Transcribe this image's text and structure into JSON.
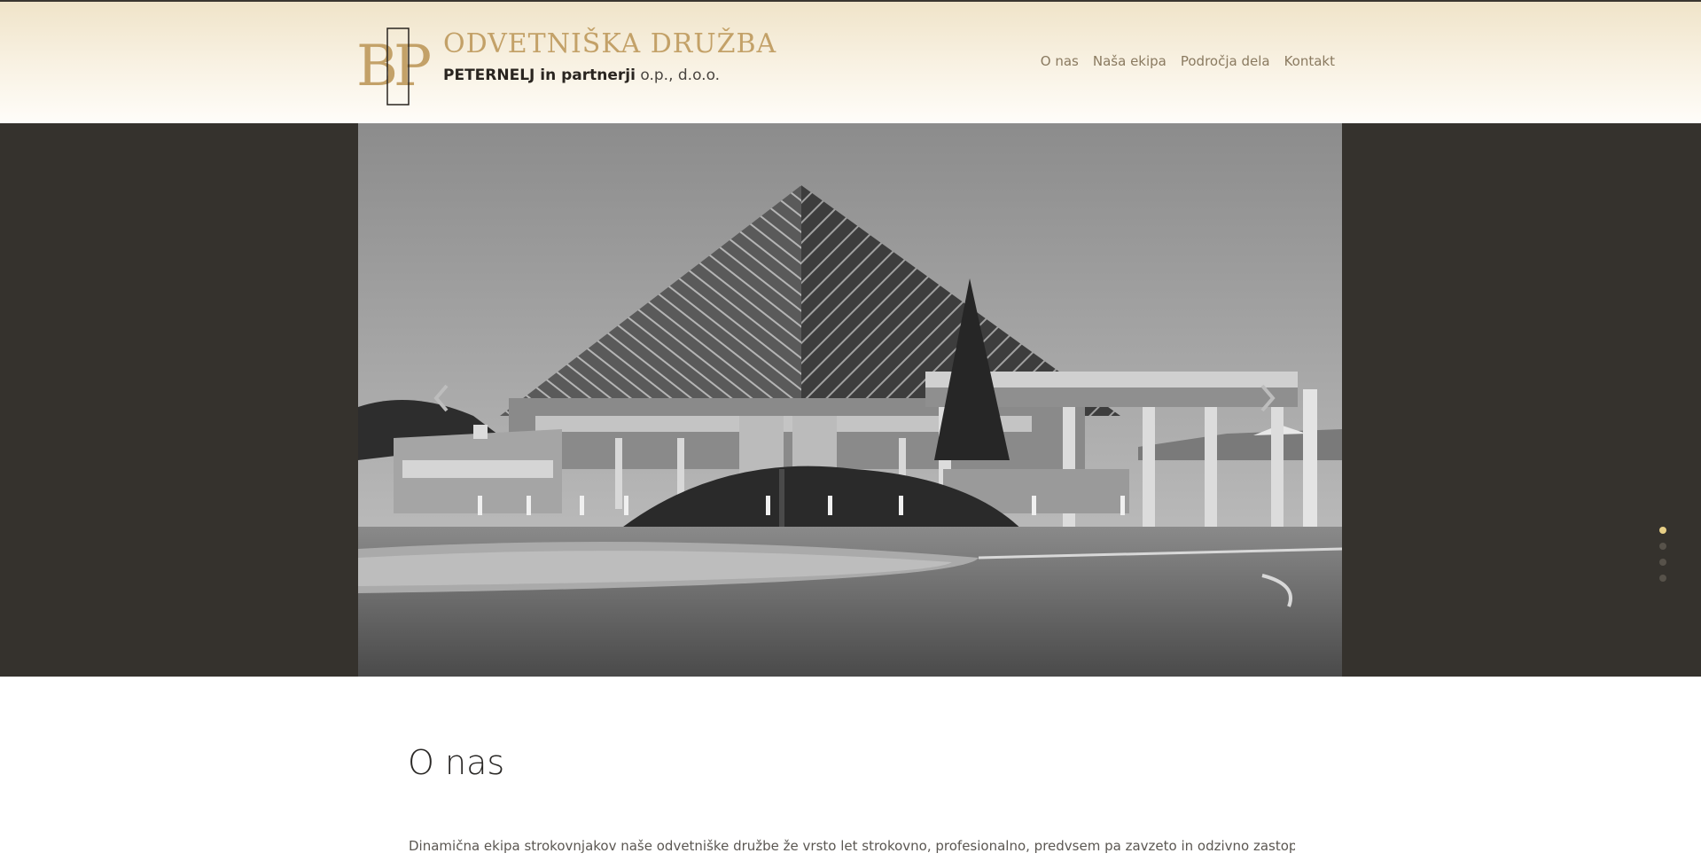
{
  "brand": {
    "logo_letters": "BP",
    "title": "ODVETNIŠKA DRUŽBA",
    "subtitle_bold": "PETERNELJ in partnerji",
    "subtitle_thin": "o.p., d.o.o."
  },
  "nav": {
    "items": [
      {
        "label": "O nas"
      },
      {
        "label": "Naša ekipa"
      },
      {
        "label": "Področja dela"
      },
      {
        "label": "Kontakt"
      }
    ]
  },
  "slider": {
    "active_index": 0,
    "slide_count": 4
  },
  "section": {
    "title": "O nas",
    "text": "Dinamična ekipa strokovnjakov naše odvetniške družbe že vrsto let strokovno, profesionalno, predvsem pa zavzeto in odzivno zastopa interese in"
  },
  "colors": {
    "brand_gold": "#c3a168",
    "hero_bg": "#35322d",
    "active_dot": "#e7cf86"
  }
}
